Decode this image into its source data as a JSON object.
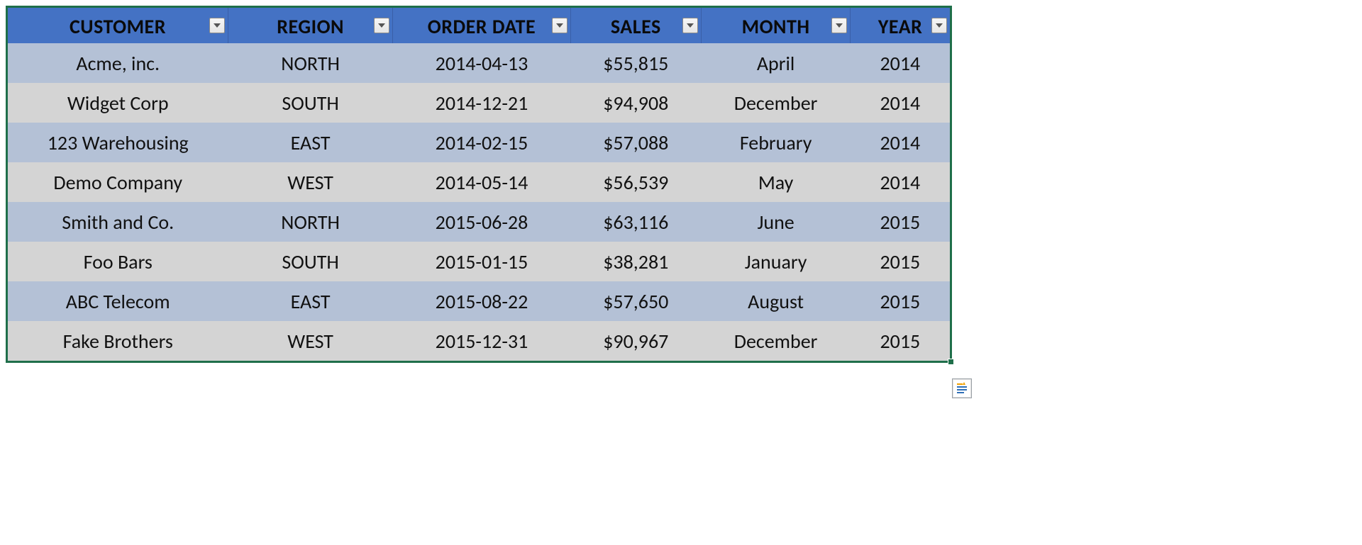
{
  "table": {
    "headers": [
      {
        "label": "CUSTOMER"
      },
      {
        "label": "REGION"
      },
      {
        "label": "ORDER DATE"
      },
      {
        "label": "SALES"
      },
      {
        "label": "MONTH"
      },
      {
        "label": "YEAR"
      }
    ],
    "rows": [
      {
        "customer": "Acme, inc.",
        "region": "NORTH",
        "order_date": "2014-04-13",
        "sales": "$55,815",
        "month": "April",
        "year": "2014"
      },
      {
        "customer": "Widget Corp",
        "region": "SOUTH",
        "order_date": "2014-12-21",
        "sales": "$94,908",
        "month": "December",
        "year": "2014"
      },
      {
        "customer": "123 Warehousing",
        "region": "EAST",
        "order_date": "2014-02-15",
        "sales": "$57,088",
        "month": "February",
        "year": "2014"
      },
      {
        "customer": "Demo Company",
        "region": "WEST",
        "order_date": "2014-05-14",
        "sales": "$56,539",
        "month": "May",
        "year": "2014"
      },
      {
        "customer": "Smith and Co.",
        "region": "NORTH",
        "order_date": "2015-06-28",
        "sales": "$63,116",
        "month": "June",
        "year": "2015"
      },
      {
        "customer": "Foo Bars",
        "region": "SOUTH",
        "order_date": "2015-01-15",
        "sales": "$38,281",
        "month": "January",
        "year": "2015"
      },
      {
        "customer": "ABC Telecom",
        "region": "EAST",
        "order_date": "2015-08-22",
        "sales": "$57,650",
        "month": "August",
        "year": "2015"
      },
      {
        "customer": "Fake Brothers",
        "region": "WEST",
        "order_date": "2015-12-31",
        "sales": "$90,967",
        "month": "December",
        "year": "2015"
      }
    ]
  }
}
